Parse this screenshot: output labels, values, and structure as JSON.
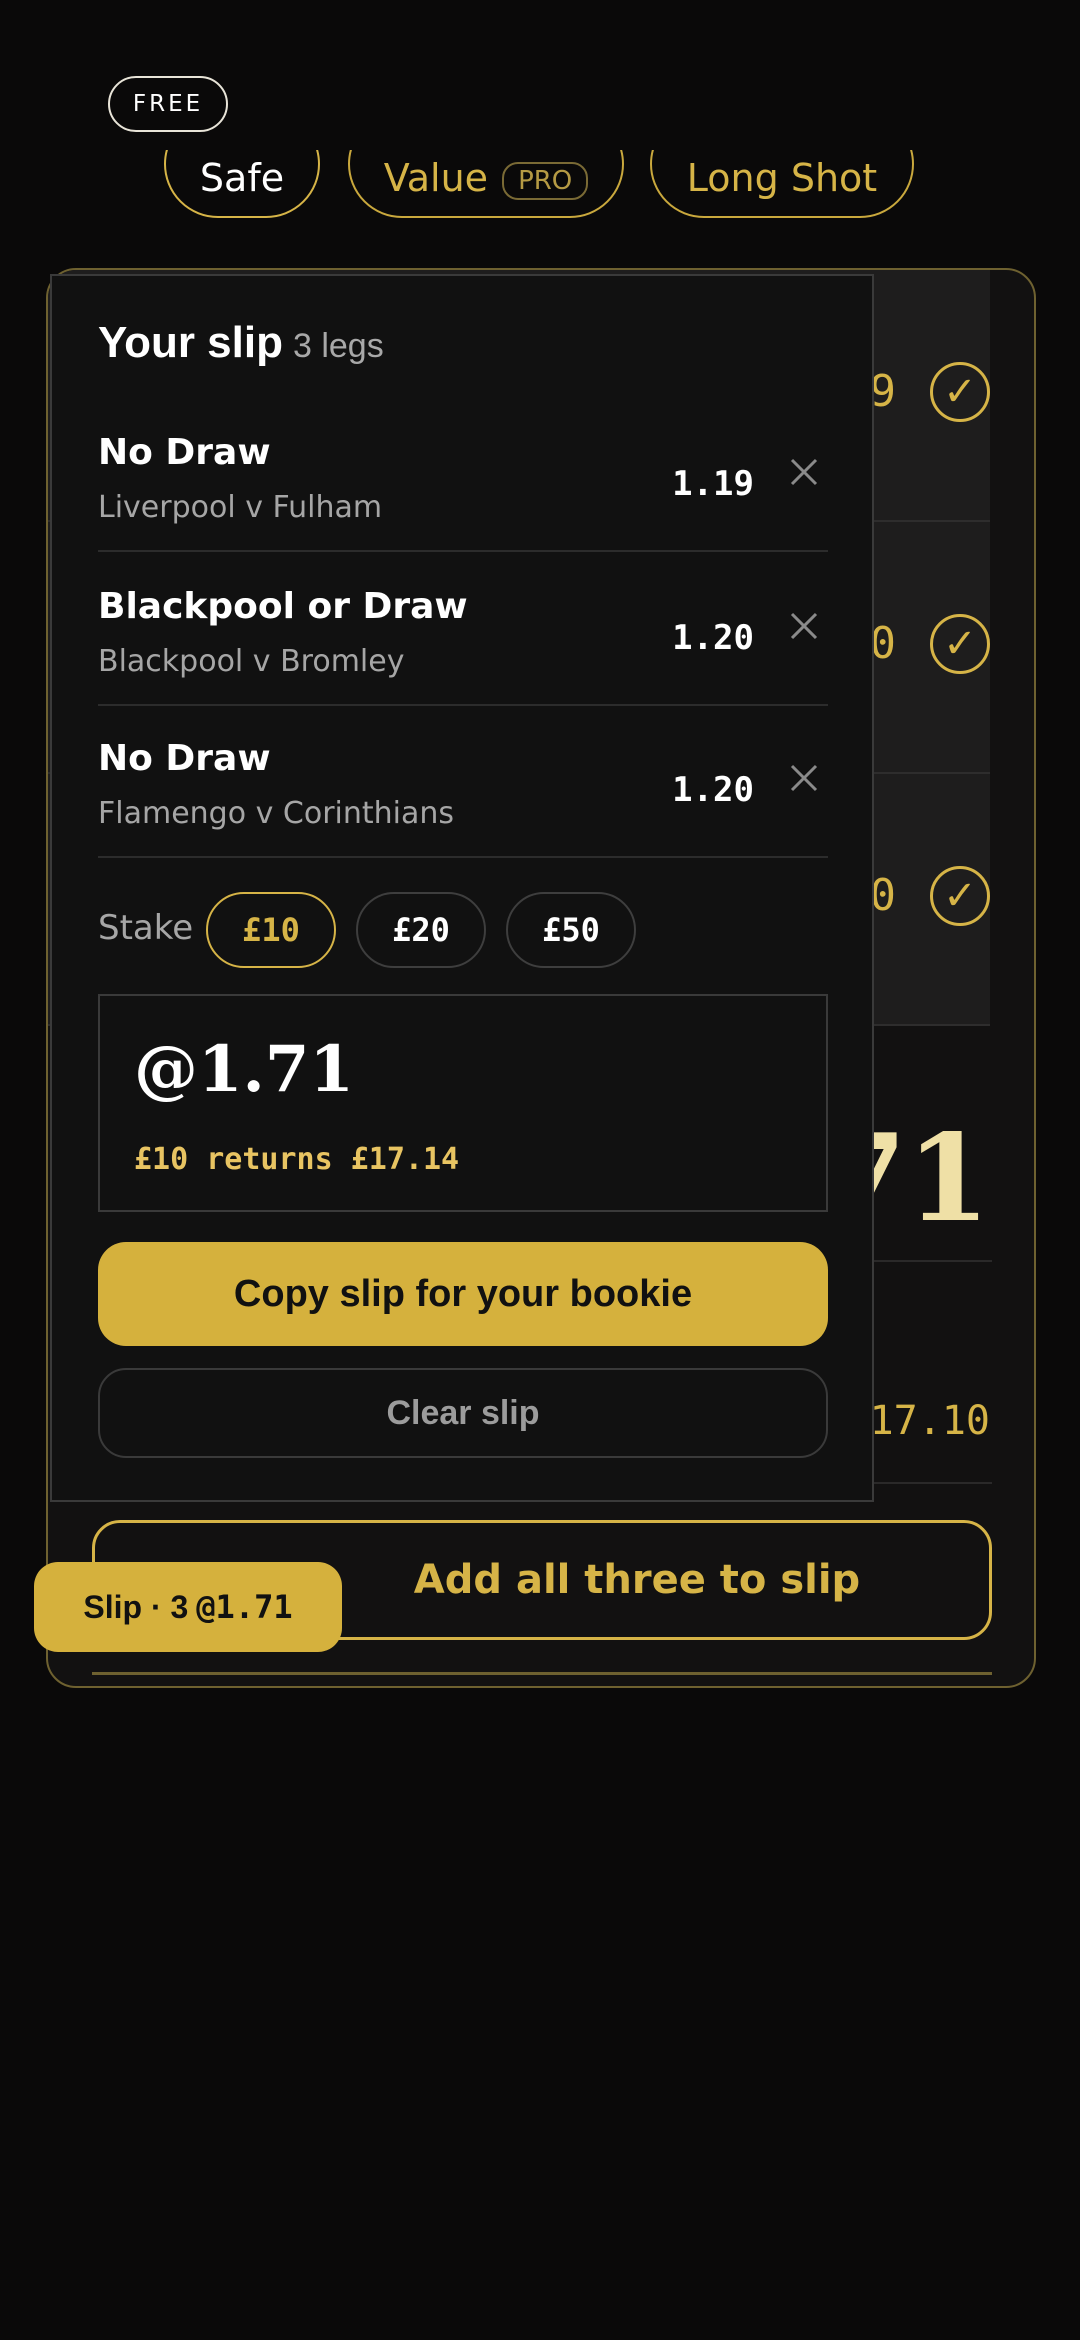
{
  "header": {
    "free_badge": "FREE"
  },
  "tabs": [
    {
      "label": "Safe",
      "active": true
    },
    {
      "label": "Value",
      "badge": "PRO",
      "active": false
    },
    {
      "label": "Long Shot",
      "active": false
    }
  ],
  "background_card": {
    "row_odds": [
      "9",
      "0",
      "0"
    ],
    "total_odds": "71",
    "returns": "17.10",
    "add_all_label": "Add all three to slip"
  },
  "slip": {
    "title": "Your slip",
    "legs_count": "3 legs",
    "legs": [
      {
        "selection": "No Draw",
        "match": "Liverpool v Fulham",
        "odds": "1.19"
      },
      {
        "selection": "Blackpool or Draw",
        "match": "Blackpool v Bromley",
        "odds": "1.20"
      },
      {
        "selection": "No Draw",
        "match": "Flamengo v Corinthians",
        "odds": "1.20"
      }
    ],
    "stake_label": "Stake",
    "stakes": [
      "£10",
      "£20",
      "£50"
    ],
    "selected_stake": "£10",
    "total_odds": "@1.71",
    "returns_text": "£10 returns £17.14",
    "copy_button": "Copy slip for your bookie",
    "clear_button": "Clear slip"
  },
  "slip_pill": {
    "label": "Slip · 3",
    "odds": "@1.71"
  },
  "colors": {
    "accent": "#d5b13d",
    "background": "#0a0909",
    "panel": "#111111"
  }
}
